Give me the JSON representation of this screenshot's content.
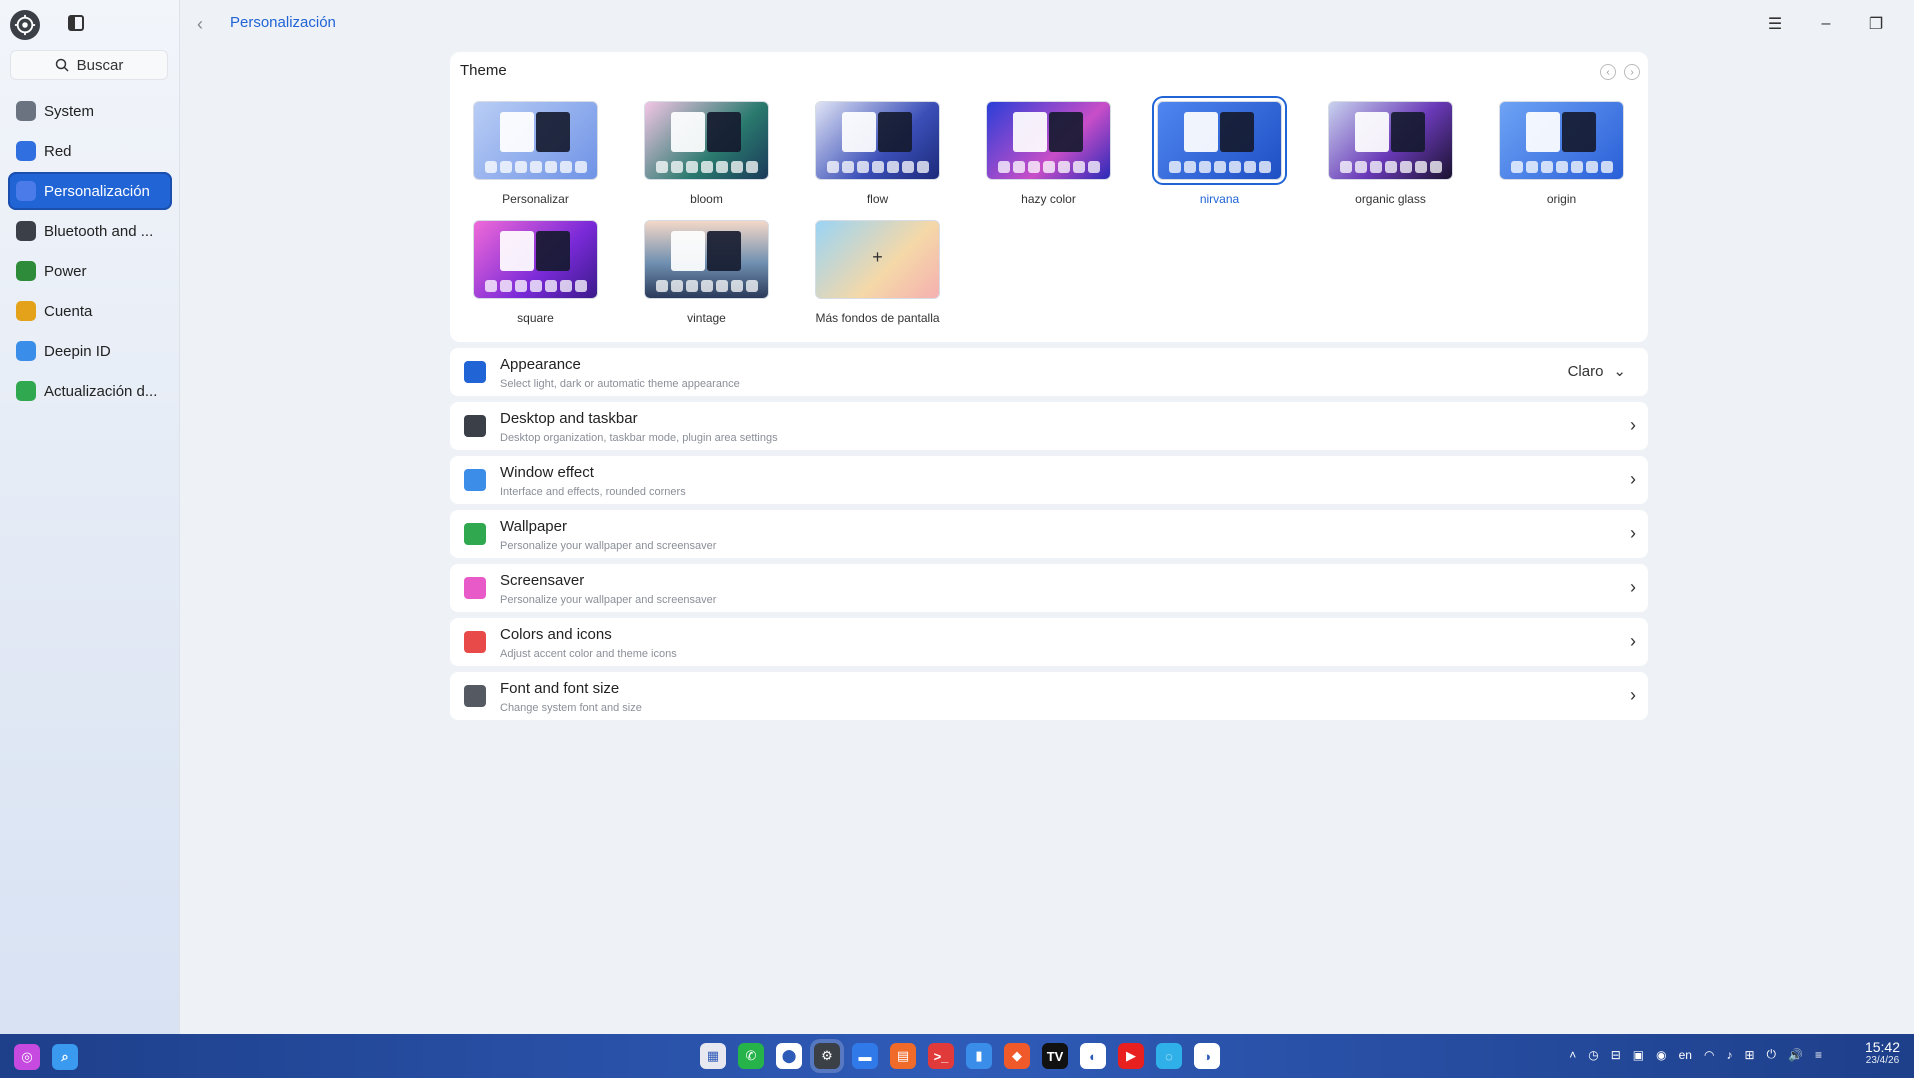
{
  "window": {
    "title": "Personalización",
    "controls": {
      "menu": "☰",
      "minimize": "–",
      "restore": "❐",
      "close": "✕"
    }
  },
  "sidebar": {
    "search_label": "Buscar",
    "items": [
      {
        "label": "System",
        "icon": "system-icon",
        "color": "#6b7280",
        "active": false
      },
      {
        "label": "Red",
        "icon": "globe-icon",
        "color": "#2f6fe0",
        "active": false
      },
      {
        "label": "Personalización",
        "icon": "palette-icon",
        "color": "#4a7be8",
        "active": true
      },
      {
        "label": "Bluetooth and ...",
        "icon": "keyboard-icon",
        "color": "#3a3f48",
        "active": false
      },
      {
        "label": "Power",
        "icon": "battery-icon",
        "color": "#2e8b3a",
        "active": false
      },
      {
        "label": "Cuenta",
        "icon": "user-icon",
        "color": "#e3a21a",
        "active": false
      },
      {
        "label": "Deepin ID",
        "icon": "cloud-icon",
        "color": "#3a8de8",
        "active": false
      },
      {
        "label": "Actualización d...",
        "icon": "update-icon",
        "color": "#2fa84f",
        "active": false
      }
    ]
  },
  "theme": {
    "title": "Theme",
    "items": [
      {
        "label": "Personalizar",
        "bg": "linear-gradient(135deg,#b9cdf5,#6f93e6)",
        "selected": false
      },
      {
        "label": "bloom",
        "bg": "linear-gradient(135deg,#f3c6e6,#2a7a6e 60%,#1a3a5a)",
        "selected": false
      },
      {
        "label": "flow",
        "bg": "linear-gradient(135deg,#dfe3f5,#3b4fb8 60%,#1c2a7a)",
        "selected": false
      },
      {
        "label": "hazy color",
        "bg": "linear-gradient(135deg,#2a3fd8,#c84ec8 60%,#2a2ab8)",
        "selected": false
      },
      {
        "label": "nirvana",
        "bg": "linear-gradient(135deg,#4f86f0,#1e4fc4)",
        "selected": true
      },
      {
        "label": "organic glass",
        "bg": "linear-gradient(135deg,#c9d2ee,#6a3ab8 55%,#1a1230)",
        "selected": false
      },
      {
        "label": "origin",
        "bg": "linear-gradient(135deg,#6ea3f5,#2a5fd8)",
        "selected": false
      },
      {
        "label": "square",
        "bg": "linear-gradient(135deg,#f06ad8,#7a2ad8 60%,#3a1a8a)",
        "selected": false
      },
      {
        "label": "vintage",
        "bg": "linear-gradient(180deg,#f3d8c8,#6f8fb0 55%,#2a3a5a)",
        "selected": false
      },
      {
        "label": "Más fondos de pantalla",
        "bg": "linear-gradient(135deg,#9ad4f5,#f5d8a8 60%,#f5b0b0)",
        "selected": false,
        "add": true
      }
    ]
  },
  "settings": [
    {
      "title": "Appearance",
      "subtitle": "Select light, dark or automatic theme appearance",
      "icon": "appearance-icon",
      "color": "#2064d6",
      "value": "Claro"
    },
    {
      "title": "Desktop and taskbar",
      "subtitle": "Desktop organization, taskbar mode, plugin area settings",
      "icon": "taskbar-icon",
      "color": "#3a3f48"
    },
    {
      "title": "Window effect",
      "subtitle": "Interface and effects, rounded corners",
      "icon": "window-icon",
      "color": "#3b8de8"
    },
    {
      "title": "Wallpaper",
      "subtitle": "Personalize your wallpaper and screensaver",
      "icon": "wallpaper-icon",
      "color": "#2fa84f"
    },
    {
      "title": "Screensaver",
      "subtitle": "Personalize your wallpaper and screensaver",
      "icon": "screensaver-icon",
      "color": "#e85ac8"
    },
    {
      "title": "Colors and icons",
      "subtitle": "Adjust accent color and theme icons",
      "icon": "colors-icon",
      "color": "#e84a4a"
    },
    {
      "title": "Font and font size",
      "subtitle": "Change system font and size",
      "icon": "font-icon",
      "color": "#555a62"
    }
  ],
  "taskbar": {
    "left": [
      {
        "name": "launcher-icon",
        "color": "#c64ae0",
        "glyph": "◎"
      },
      {
        "name": "search-app-icon",
        "color": "#3a9af0",
        "glyph": "⌕"
      }
    ],
    "apps": [
      {
        "name": "app-grid-icon",
        "color": "#e8e8f0",
        "glyph": "▦"
      },
      {
        "name": "whatsapp-icon",
        "color": "#25b34a",
        "glyph": "✆"
      },
      {
        "name": "maps-icon",
        "color": "#ffffff",
        "glyph": "⬤"
      },
      {
        "name": "settings-app-icon",
        "color": "#3b3f46",
        "glyph": "⚙",
        "active": true
      },
      {
        "name": "files-icon",
        "color": "#2f7ae8",
        "glyph": "▬"
      },
      {
        "name": "store-icon",
        "color": "#f06a2a",
        "glyph": "▤"
      },
      {
        "name": "terminal-icon",
        "color": "#e03a3a",
        "glyph": ">_"
      },
      {
        "name": "editor-icon",
        "color": "#3a8de8",
        "glyph": "▮"
      },
      {
        "name": "brave-icon",
        "color": "#f05a2a",
        "glyph": "◆"
      },
      {
        "name": "tradingview-icon",
        "color": "#111111",
        "glyph": "TV"
      },
      {
        "name": "browser-icon",
        "color": "#ffffff",
        "glyph": "◐"
      },
      {
        "name": "youtube-icon",
        "color": "#e82020",
        "glyph": "▶"
      },
      {
        "name": "deepin-icon",
        "color": "#2fb0e8",
        "glyph": "◌"
      },
      {
        "name": "browser2-icon",
        "color": "#ffffff",
        "glyph": "◑"
      }
    ],
    "tray": [
      "˄",
      "◷",
      "⊟",
      "▣",
      "◉",
      "en",
      "◠",
      "♪",
      "⊞",
      "⏻",
      "🔊",
      "≡"
    ],
    "time": "15:42",
    "date": "23/4/26"
  }
}
